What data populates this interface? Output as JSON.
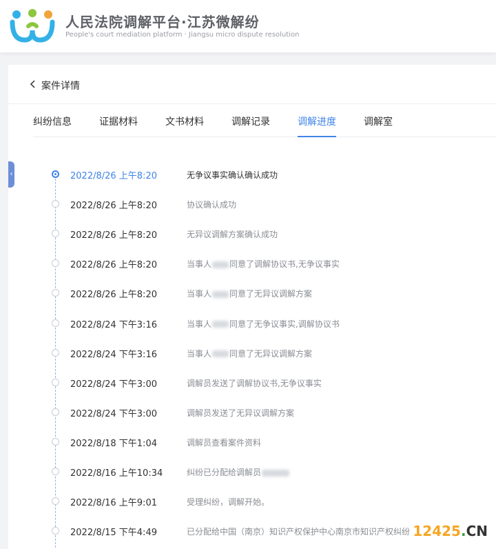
{
  "header": {
    "title_cn": "人民法院调解平台·江苏微解纷",
    "title_en": "People's court mediation platform · Jiangsu micro dispute resolution",
    "logo_colors": [
      "#33b1e6",
      "#8dc63f",
      "#f2a33a"
    ]
  },
  "case": {
    "title": "案件详情"
  },
  "tabs": [
    {
      "label": "纠纷信息"
    },
    {
      "label": "证据材料"
    },
    {
      "label": "文书材料"
    },
    {
      "label": "调解记录"
    },
    {
      "label": "调解进度"
    },
    {
      "label": "调解室"
    }
  ],
  "active_tab_index": 4,
  "timeline": [
    {
      "time": "2022/8/26 上午8:20",
      "pre": "无争议事实确认确认成功",
      "post": ""
    },
    {
      "time": "2022/8/26 上午8:20",
      "pre": "协议确认成功",
      "post": ""
    },
    {
      "time": "2022/8/26 上午8:20",
      "pre": "无异议调解方案确认成功",
      "post": ""
    },
    {
      "time": "2022/8/26 上午8:20",
      "pre": "当事人",
      "post": "同意了调解协议书,无争议事实"
    },
    {
      "time": "2022/8/26 上午8:20",
      "pre": "当事人",
      "post": "同意了无异议调解方案"
    },
    {
      "time": "2022/8/24 下午3:16",
      "pre": "当事人",
      "post": "同意了无争议事实,调解协议书"
    },
    {
      "time": "2022/8/24 下午3:16",
      "pre": "当事人",
      "post": "同意了无异议调解方案"
    },
    {
      "time": "2022/8/24 下午3:00",
      "pre": "调解员发送了调解协议书,无争议事实",
      "post": ""
    },
    {
      "time": "2022/8/24 下午3:00",
      "pre": "调解员发送了无异议调解方案",
      "post": ""
    },
    {
      "time": "2022/8/18 下午1:04",
      "pre": "调解员查看案件资料",
      "post": ""
    },
    {
      "time": "2022/8/16 上午10:34",
      "pre": "纠纷已分配给调解员",
      "post": ""
    },
    {
      "time": "2022/8/16 上午9:01",
      "pre": "受理纠纷，调解开始。",
      "post": ""
    },
    {
      "time": "2022/8/15 下午4:49",
      "pre": "已分配给中国（南京）知识产权保护中心南京市知识产权纠纷",
      "post": ""
    }
  ],
  "watermark": {
    "num": "12425",
    "dot": ".",
    "cn": "CN"
  },
  "colors": {
    "accent": "#3e84e8",
    "text": "#303133",
    "muted": "#8a8d93"
  }
}
